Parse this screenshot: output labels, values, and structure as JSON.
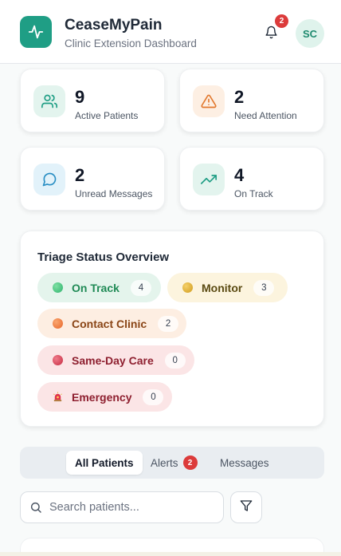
{
  "header": {
    "title": "CeaseMyPain",
    "subtitle": "Clinic Extension Dashboard",
    "notification_count": "2",
    "avatar_initials": "SC",
    "brand_color": "#1f9e85"
  },
  "stats": [
    {
      "value": "9",
      "label": "Active Patients",
      "icon": "users-icon"
    },
    {
      "value": "2",
      "label": "Need Attention",
      "icon": "alert-triangle-icon"
    },
    {
      "value": "2",
      "label": "Unread Messages",
      "icon": "message-circle-icon"
    },
    {
      "value": "4",
      "label": "On Track",
      "icon": "trending-up-icon"
    }
  ],
  "triage": {
    "title": "Triage Status Overview",
    "statuses": [
      {
        "label": "On Track",
        "count": "4",
        "color": "#2fb36e"
      },
      {
        "label": "Monitor",
        "count": "3",
        "color": "#e0b02a"
      },
      {
        "label": "Contact Clinic",
        "count": "2",
        "color": "#f07a3c"
      },
      {
        "label": "Same-Day Care",
        "count": "0",
        "color": "#d63a4f"
      },
      {
        "label": "Emergency",
        "count": "0",
        "icon": "siren-icon"
      }
    ]
  },
  "tabs": [
    {
      "label": "All Patients"
    },
    {
      "label": "Alerts",
      "badge": "2"
    },
    {
      "label": "Messages"
    }
  ],
  "search": {
    "placeholder": "Search patients..."
  }
}
